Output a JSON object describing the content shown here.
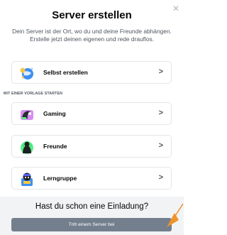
{
  "modal": {
    "title": "Server erstellen",
    "subtitle_line1": "Dein Server ist der Ort, wo du und deine Freunde abhängen.",
    "subtitle_line2": "Erstelle jetzt deinen eigenen und rede drauflos.",
    "close_icon": "close-icon"
  },
  "create_own": {
    "label": "Selbst erstellen",
    "icon": "globe-create-icon"
  },
  "templates": {
    "section_label": "MIT EINER VORLAGE STARTEN",
    "items": [
      {
        "label": "Gaming",
        "icon": "gaming-template-icon"
      },
      {
        "label": "Freunde",
        "icon": "friends-template-icon"
      },
      {
        "label": "Lerngruppe",
        "icon": "study-group-template-icon"
      }
    ]
  },
  "footer": {
    "title": "Hast du schon eine Einladung?",
    "join_button": "Tritt einem Server bei"
  },
  "colors": {
    "accent_arrow": "#f0932b",
    "button_gray": "#747f8d",
    "footer_bg": "#f2f3f5"
  }
}
